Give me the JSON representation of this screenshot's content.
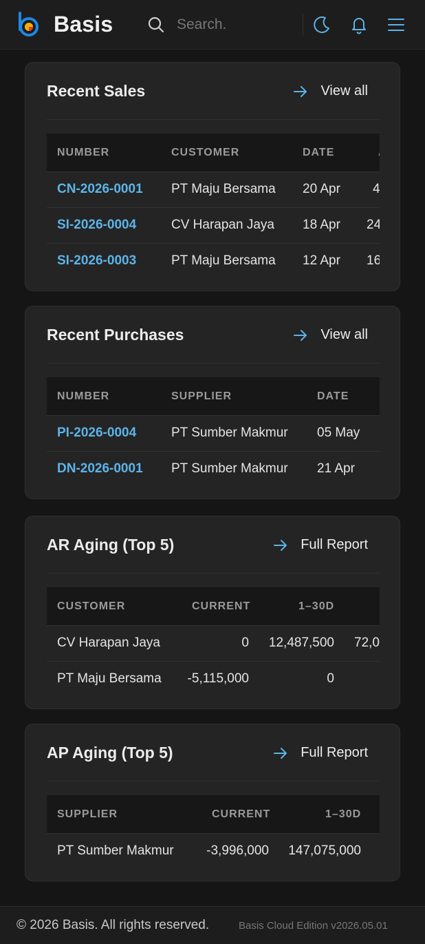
{
  "header": {
    "brand": "Basis",
    "search_placeholder": "Search.",
    "icons": [
      "logo-icon",
      "search-icon",
      "moon-icon",
      "bell-icon",
      "menu-icon"
    ],
    "accent_color": "#1e88e5"
  },
  "recent_sales": {
    "title": "Recent Sales",
    "link": "View all",
    "columns": [
      "NUMBER",
      "CUSTOMER",
      "DATE",
      "A"
    ],
    "rows": [
      {
        "number": "CN-2026-0001",
        "customer": "PT Maju Bersama",
        "date": "20 Apr",
        "amount": "4"
      },
      {
        "number": "SI-2026-0004",
        "customer": "CV Harapan Jaya",
        "date": "18 Apr",
        "amount": "24"
      },
      {
        "number": "SI-2026-0003",
        "customer": "PT Maju Bersama",
        "date": "12 Apr",
        "amount": "16"
      }
    ]
  },
  "recent_purchases": {
    "title": "Recent Purchases",
    "link": "View all",
    "columns": [
      "NUMBER",
      "SUPPLIER",
      "DATE"
    ],
    "rows": [
      {
        "number": "PI-2026-0004",
        "supplier": "PT Sumber Makmur",
        "date": "05 May"
      },
      {
        "number": "DN-2026-0001",
        "supplier": "PT Sumber Makmur",
        "date": "21 Apr"
      }
    ]
  },
  "ar_aging": {
    "title": "AR Aging (Top 5)",
    "link": "Full Report",
    "columns": [
      "CUSTOMER",
      "CURRENT",
      "1–30D"
    ],
    "rows": [
      {
        "name": "CV Harapan Jaya",
        "current": "0",
        "d1_30": "12,487,500",
        "d31": "72,0"
      },
      {
        "name": "PT Maju Bersama",
        "current": "-5,115,000",
        "d1_30": "0",
        "d31": ""
      }
    ]
  },
  "ap_aging": {
    "title": "AP Aging (Top 5)",
    "link": "Full Report",
    "columns": [
      "SUPPLIER",
      "CURRENT",
      "1–30D"
    ],
    "rows": [
      {
        "name": "PT Sumber Makmur",
        "current": "-3,996,000",
        "d1_30": "147,075,000"
      }
    ]
  },
  "footer": {
    "copyright": "© 2026 Basis. All rights reserved.",
    "version": "Basis Cloud Edition v2026.05.01"
  },
  "colors": {
    "background": "#151515",
    "card": "#242424",
    "link": "#5cb4e8",
    "header": "#1d1d1d"
  }
}
